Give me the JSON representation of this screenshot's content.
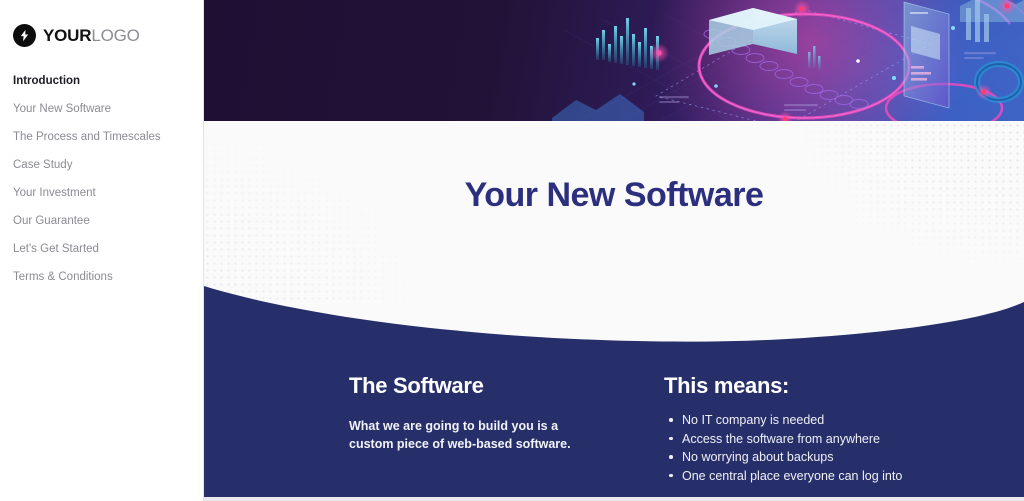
{
  "sidebar": {
    "logo": {
      "icon": "lightning-bolt-icon",
      "bold_part": "YOUR",
      "light_part": "LOGO"
    },
    "items": [
      {
        "label": "Introduction",
        "active": true
      },
      {
        "label": "Your New Software",
        "active": false
      },
      {
        "label": "The Process and Timescales",
        "active": false
      },
      {
        "label": "Case Study",
        "active": false
      },
      {
        "label": "Your Investment",
        "active": false
      },
      {
        "label": "Our Guarantee",
        "active": false
      },
      {
        "label": "Let's Get Started",
        "active": false
      },
      {
        "label": "Terms & Conditions",
        "active": false
      }
    ]
  },
  "document": {
    "hero_image_alt": "isometric data dashboard illustration",
    "title": "Your New Software",
    "left_block": {
      "heading": "The Software",
      "body": "What we are going to build you is a custom piece of web-based software."
    },
    "right_block": {
      "heading": "This means:",
      "bullets": [
        "No IT company is needed",
        "Access the software from anywhere",
        "No worrying about backups",
        "One central place everyone can log into"
      ]
    }
  },
  "colors": {
    "navy": "#272F6B",
    "title_indigo": "#2B2F7E",
    "hero_dark_purple": "#201238",
    "sidebar_text": "#8B8B92",
    "sidebar_active_text": "#1C1C22",
    "page_bg": "#FAFAFA"
  }
}
